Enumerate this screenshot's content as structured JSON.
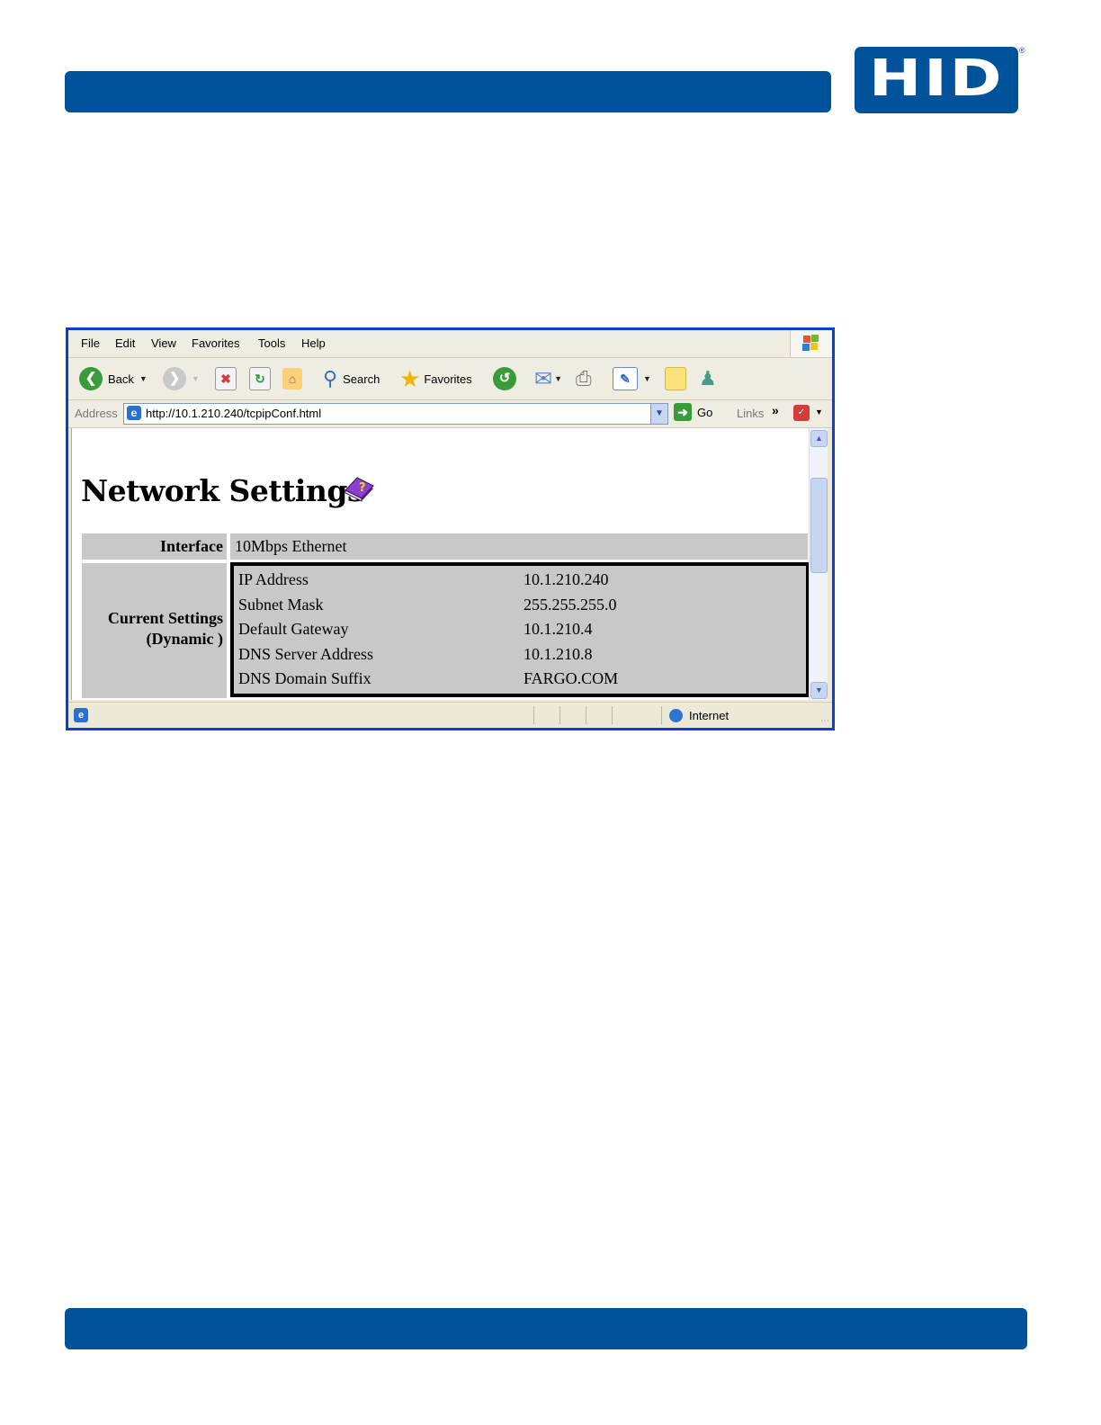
{
  "document": {
    "logo_text": "HID",
    "logo_mark": "®",
    "brand_color": "#00539b"
  },
  "browser": {
    "menu": [
      "File",
      "Edit",
      "View",
      "Favorites",
      "Tools",
      "Help"
    ],
    "toolbar": {
      "back_label": "Back",
      "search_label": "Search",
      "favorites_label": "Favorites"
    },
    "address": {
      "label": "Address",
      "url": "http://10.1.210.240/tcpipConf.html",
      "go_label": "Go",
      "links_label": "Links"
    },
    "status": {
      "zone": "Internet"
    }
  },
  "page": {
    "title": "Network Settings",
    "interface_label": "Interface",
    "interface_value": "10Mbps Ethernet",
    "current_label_line1": "Current Settings",
    "current_label_line2": "(Dynamic )",
    "settings": [
      {
        "name": "IP Address",
        "value": "10.1.210.240"
      },
      {
        "name": "Subnet Mask",
        "value": "255.255.255.0"
      },
      {
        "name": "Default Gateway",
        "value": "10.1.210.4"
      },
      {
        "name": "DNS Server Address",
        "value": "10.1.210.8"
      },
      {
        "name": "DNS Domain Suffix",
        "value": "FARGO.COM"
      }
    ]
  }
}
